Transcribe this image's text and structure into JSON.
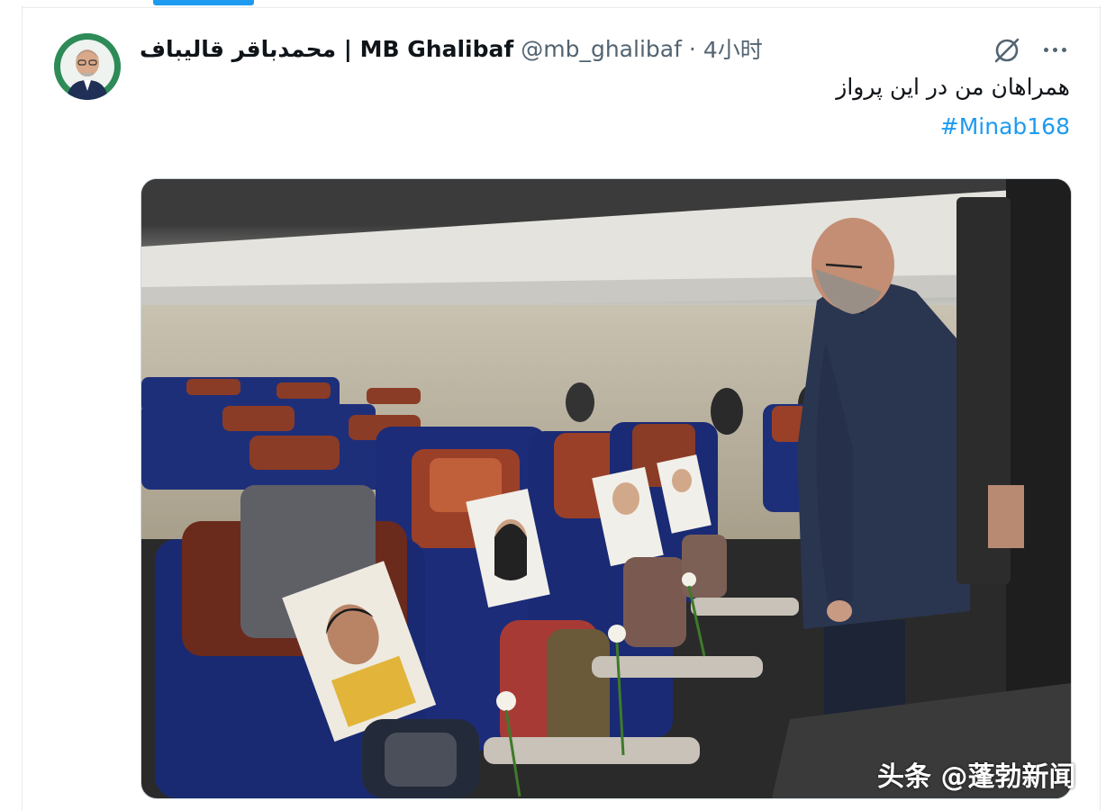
{
  "tweet": {
    "display_name": "محمدباقر قالیباف | MB Ghalibaf",
    "handle": "@mb_ghalibaf",
    "separator": "·",
    "time": "4小时",
    "text": "همراهان من در این پرواز",
    "hashtag": "#Minab168"
  },
  "icons": {
    "grok": "grok-icon",
    "more": "more-options-icon"
  },
  "watermark": "头条 @蓬勃新闻",
  "colors": {
    "link": "#1d9bf0",
    "secondary_text": "#536471",
    "primary_text": "#0f1419",
    "seat_blue": "#1e2f7a",
    "headrest_rust": "#a3462c"
  }
}
